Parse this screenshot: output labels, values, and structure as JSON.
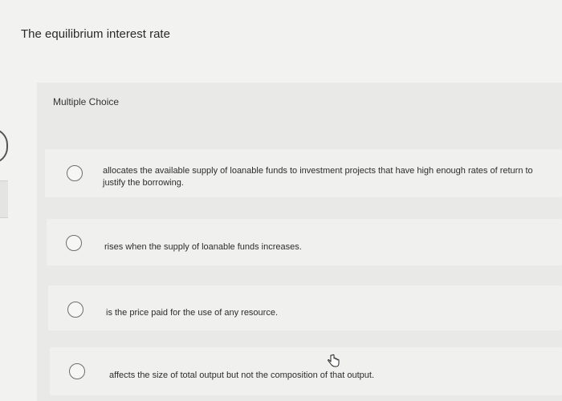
{
  "question": {
    "text": "The equilibrium interest rate"
  },
  "panel": {
    "label": "Multiple Choice"
  },
  "choices": [
    {
      "text": "allocates the available supply of loanable funds to investment projects that have high enough rates of return to justify the borrowing."
    },
    {
      "text": "rises when the supply of loanable funds increases."
    },
    {
      "text": "is the price paid for the use of any resource."
    },
    {
      "text": "affects the size of total output but not the composition of that output."
    }
  ],
  "icons": {
    "radio": "radio-circle-icon",
    "cursor": "hand-pointer-icon"
  }
}
